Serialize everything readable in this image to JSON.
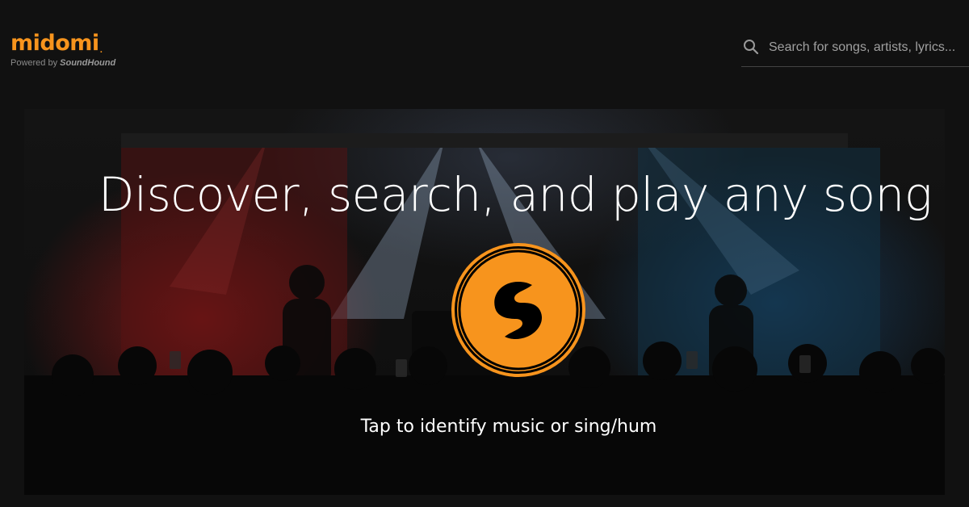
{
  "header": {
    "logo_text": "midomi",
    "logo_reg": ".",
    "powered_prefix": "Powered by ",
    "powered_brand": "SoundHound",
    "search_placeholder": "Search for songs, artists, lyrics..."
  },
  "hero": {
    "title": "Discover, search, and play any song",
    "caption": "Tap to identify music or sing/hum"
  },
  "colors": {
    "accent": "#f7941d",
    "background": "#111111"
  },
  "icons": {
    "search": "search-icon",
    "listen": "soundhound-logo-icon"
  }
}
